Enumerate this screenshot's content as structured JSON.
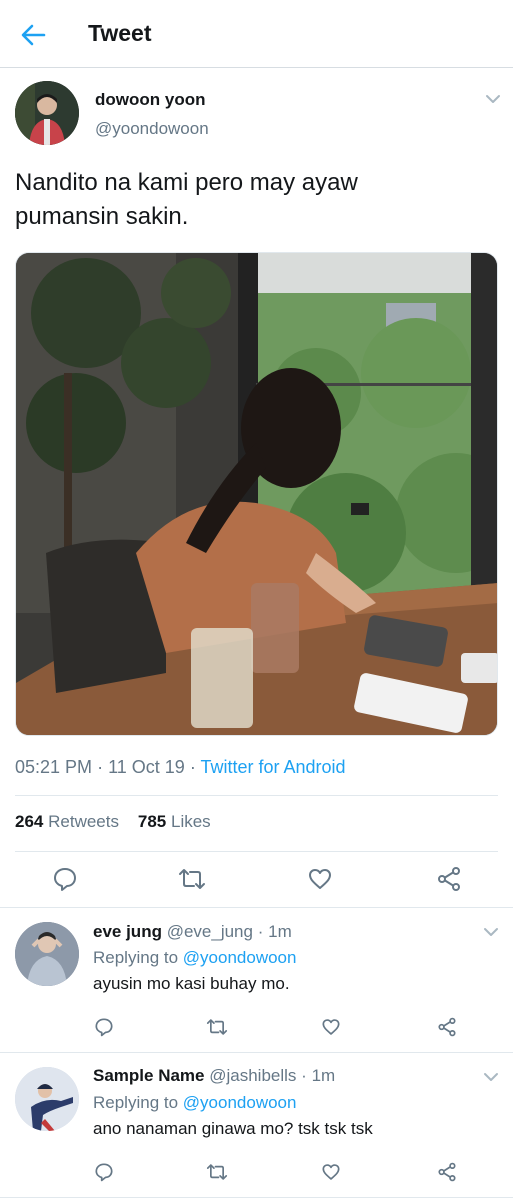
{
  "header": {
    "title": "Tweet",
    "back_icon": "arrow-left-icon",
    "accent": "#1da1f2"
  },
  "tweet": {
    "name": "dowoon yoon",
    "handle": "@yoondowoon",
    "text_line1": "Nandito na kami pero may ayaw",
    "text_line2": "pumansin sakin.",
    "time": "05:21 PM",
    "date": "11 Oct 19",
    "separator": "·",
    "source": "Twitter for Android",
    "retweets_count": "264",
    "retweets_label": "Retweets",
    "likes_count": "785",
    "likes_label": "Likes"
  },
  "replies": [
    {
      "name": "eve jung",
      "handle": "@eve_jung",
      "time": "1m",
      "replying_prefix": "Replying to",
      "replying_to": "@yoondowoon",
      "text": "ayusin mo kasi buhay mo."
    },
    {
      "name": "Sample Name",
      "handle": "@jashibells",
      "time": "1m",
      "replying_prefix": "Replying to",
      "replying_to": "@yoondowoon",
      "text": "ano nanaman ginawa mo? tsk tsk tsk"
    }
  ],
  "icons": [
    "reply-icon",
    "retweet-icon",
    "like-icon",
    "share-icon",
    "chevron-down-icon"
  ]
}
